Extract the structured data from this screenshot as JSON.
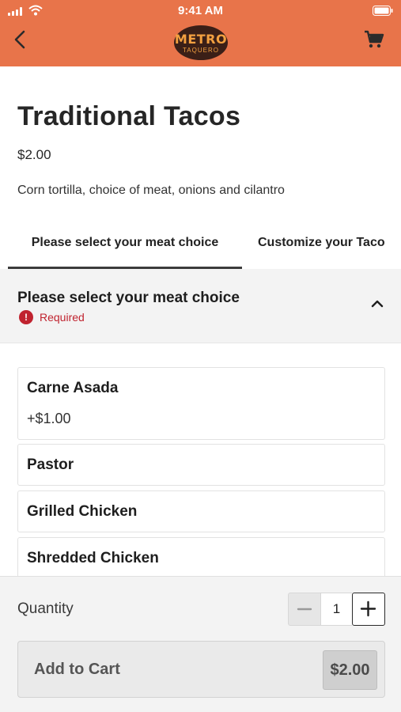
{
  "status_bar": {
    "time": "9:41 AM"
  },
  "header": {
    "logo_text": "METRO",
    "logo_sub": "TAQUERO",
    "back_icon": "chevron-left-icon",
    "cart_icon": "shopping-cart-icon",
    "color": "#e8744a"
  },
  "product": {
    "title": "Traditional Tacos",
    "price": "$2.00",
    "description": "Corn tortilla, choice of meat, onions and cilantro"
  },
  "tabs": [
    {
      "label": "Please select your meat choice",
      "active": true
    },
    {
      "label": "Customize your Taco",
      "active": false
    }
  ],
  "meat_section": {
    "title": "Please select your meat choice",
    "required_label": "Required",
    "expanded": true,
    "options": [
      {
        "name": "Carne Asada",
        "price": "+$1.00"
      },
      {
        "name": "Pastor",
        "price": ""
      },
      {
        "name": "Grilled Chicken",
        "price": ""
      },
      {
        "name": "Shredded Chicken",
        "price": ""
      }
    ]
  },
  "footer": {
    "quantity_label": "Quantity",
    "quantity_value": "1",
    "add_to_cart_label": "Add to Cart",
    "add_to_cart_price": "$2.00"
  }
}
